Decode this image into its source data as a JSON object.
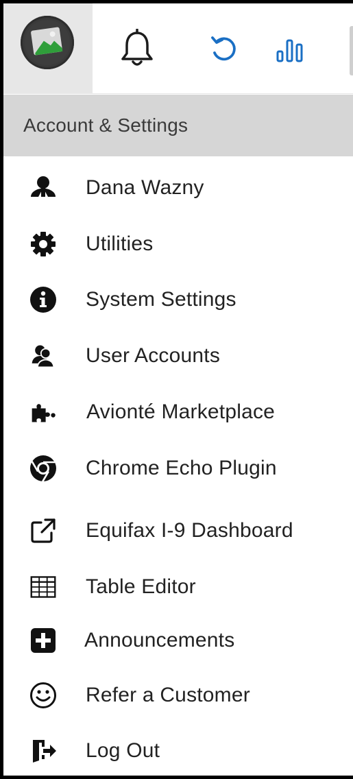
{
  "toolbar": {
    "icons": [
      "avatar",
      "bell-icon",
      "refresh-icon",
      "bar-chart-icon"
    ],
    "accent_color": "#1a6fc4"
  },
  "section": {
    "title": "Account & Settings"
  },
  "menu": {
    "items": [
      {
        "label": "Dana Wazny",
        "icon": "user-icon"
      },
      {
        "label": "Utilities",
        "icon": "gear-icon"
      },
      {
        "label": "System Settings",
        "icon": "info-icon"
      },
      {
        "label": "User Accounts",
        "icon": "users-icon"
      },
      {
        "label": "Avionté Marketplace",
        "icon": "puzzle-icon"
      },
      {
        "label": "Chrome Echo Plugin",
        "icon": "chrome-icon"
      },
      {
        "label": "Equifax I-9 Dashboard",
        "icon": "external-link-icon"
      },
      {
        "label": "Table Editor",
        "icon": "table-icon"
      },
      {
        "label": "Announcements",
        "icon": "plus-square-icon"
      },
      {
        "label": "Refer a Customer",
        "icon": "smile-icon"
      },
      {
        "label": "Log Out",
        "icon": "logout-icon"
      }
    ]
  }
}
